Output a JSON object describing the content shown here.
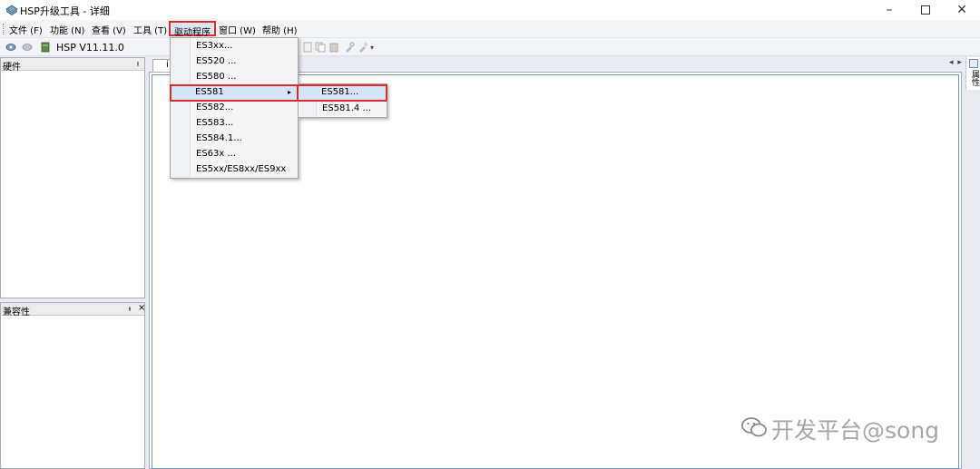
{
  "window": {
    "title": "HSP升级工具 - 详细"
  },
  "menubar": {
    "items": [
      {
        "label": "文件 (F)"
      },
      {
        "label": "功能 (N)"
      },
      {
        "label": "查看 (V)"
      },
      {
        "label": "工具 (T)"
      },
      {
        "label": "驱动程序"
      },
      {
        "label": "窗口 (W)"
      },
      {
        "label": "帮助 (H)"
      }
    ]
  },
  "toolbar": {
    "version": "HSP V11.11.0"
  },
  "panes": {
    "hardware": {
      "title": "硬件",
      "pin": "ᵼ"
    },
    "compat": {
      "title": "兼容性",
      "pin": "ᵼ",
      "close": "×"
    }
  },
  "document": {
    "tab_label": "i",
    "nav": "◂ ▸",
    "close": "×"
  },
  "right_panel": {
    "label": "属性"
  },
  "driver_menu": {
    "items": [
      {
        "label": "ES3xx..."
      },
      {
        "label": "ES520 ..."
      },
      {
        "label": "ES580 ..."
      },
      {
        "label": "ES581"
      },
      {
        "label": "ES582..."
      },
      {
        "label": "ES583..."
      },
      {
        "label": "ES584.1..."
      },
      {
        "label": "ES63x ..."
      },
      {
        "label": "ES5xx/ES8xx/ES9xx"
      }
    ],
    "submenu": [
      {
        "label": "ES581..."
      },
      {
        "label": "ES581.4 ..."
      }
    ]
  },
  "watermark": {
    "text": "开发平台@song"
  },
  "colors": {
    "highlight_border": "#e02b2b",
    "selection": "#d6e4f7",
    "accent_blue": "#6f93c6"
  }
}
